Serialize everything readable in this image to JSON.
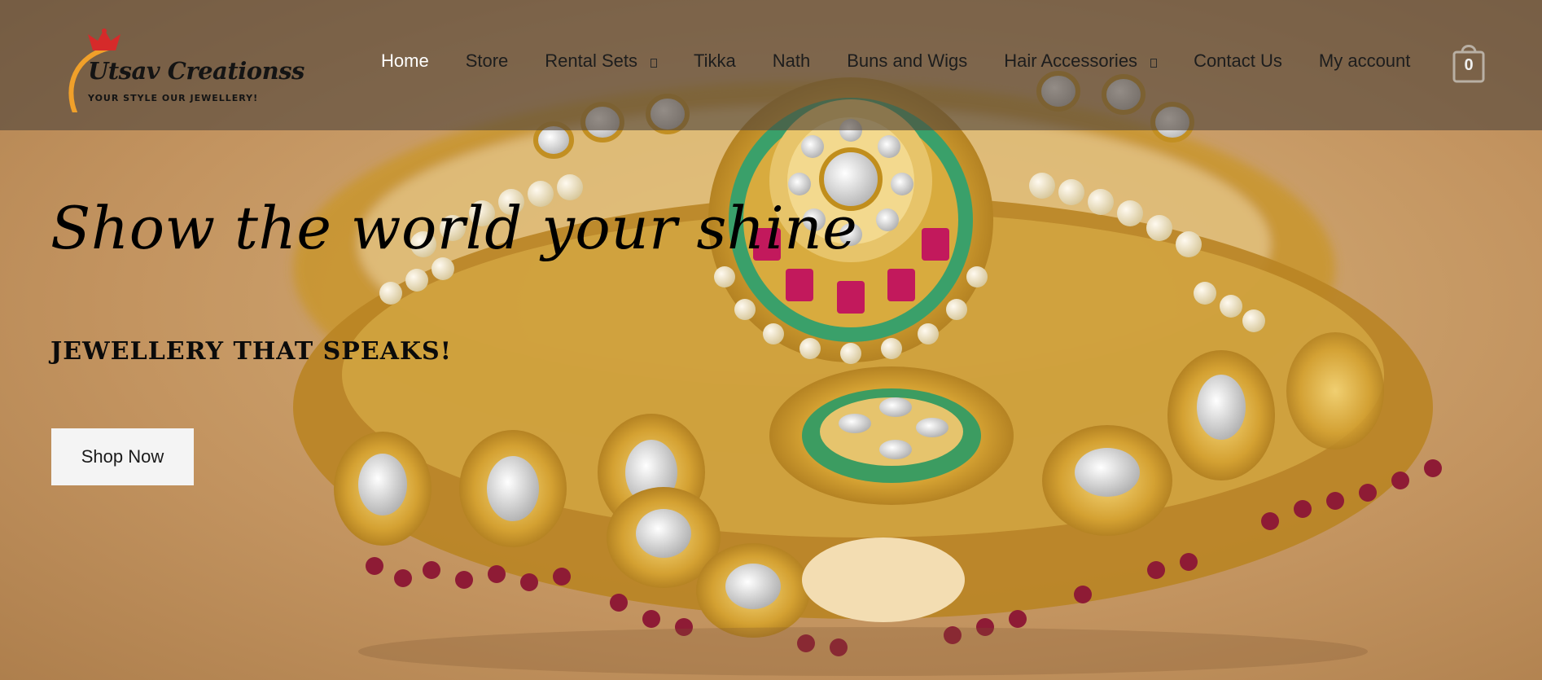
{
  "logo": {
    "title": "Utsav Creationss",
    "tagline": "YOUR STYLE OUR JEWELLERY!"
  },
  "nav": {
    "items": [
      {
        "label": "Home",
        "active": true,
        "dropdown": false
      },
      {
        "label": "Store",
        "active": false,
        "dropdown": false
      },
      {
        "label": "Rental Sets",
        "active": false,
        "dropdown": true
      },
      {
        "label": "Tikka",
        "active": false,
        "dropdown": false
      },
      {
        "label": "Nath",
        "active": false,
        "dropdown": false
      },
      {
        "label": "Buns and Wigs",
        "active": false,
        "dropdown": false
      },
      {
        "label": "Hair Accessories",
        "active": false,
        "dropdown": true
      },
      {
        "label": "Contact Us",
        "active": false,
        "dropdown": false
      },
      {
        "label": "My account",
        "active": false,
        "dropdown": false
      }
    ]
  },
  "cart": {
    "count": "0",
    "icon": "shopping-bag-icon"
  },
  "hero": {
    "title": "Show the world your shine",
    "subtitle": "JEWELLERY THAT SPEAKS!",
    "button_label": "Shop Now",
    "image_description_icon": "jewellery-necklace-image"
  },
  "colors": {
    "header_overlay": "#504637",
    "background_gold": "#c79a5d",
    "button_bg": "#f4f4f4",
    "logo_accent_orange": "#f0a02a",
    "logo_crown_red": "#d62a2a"
  }
}
